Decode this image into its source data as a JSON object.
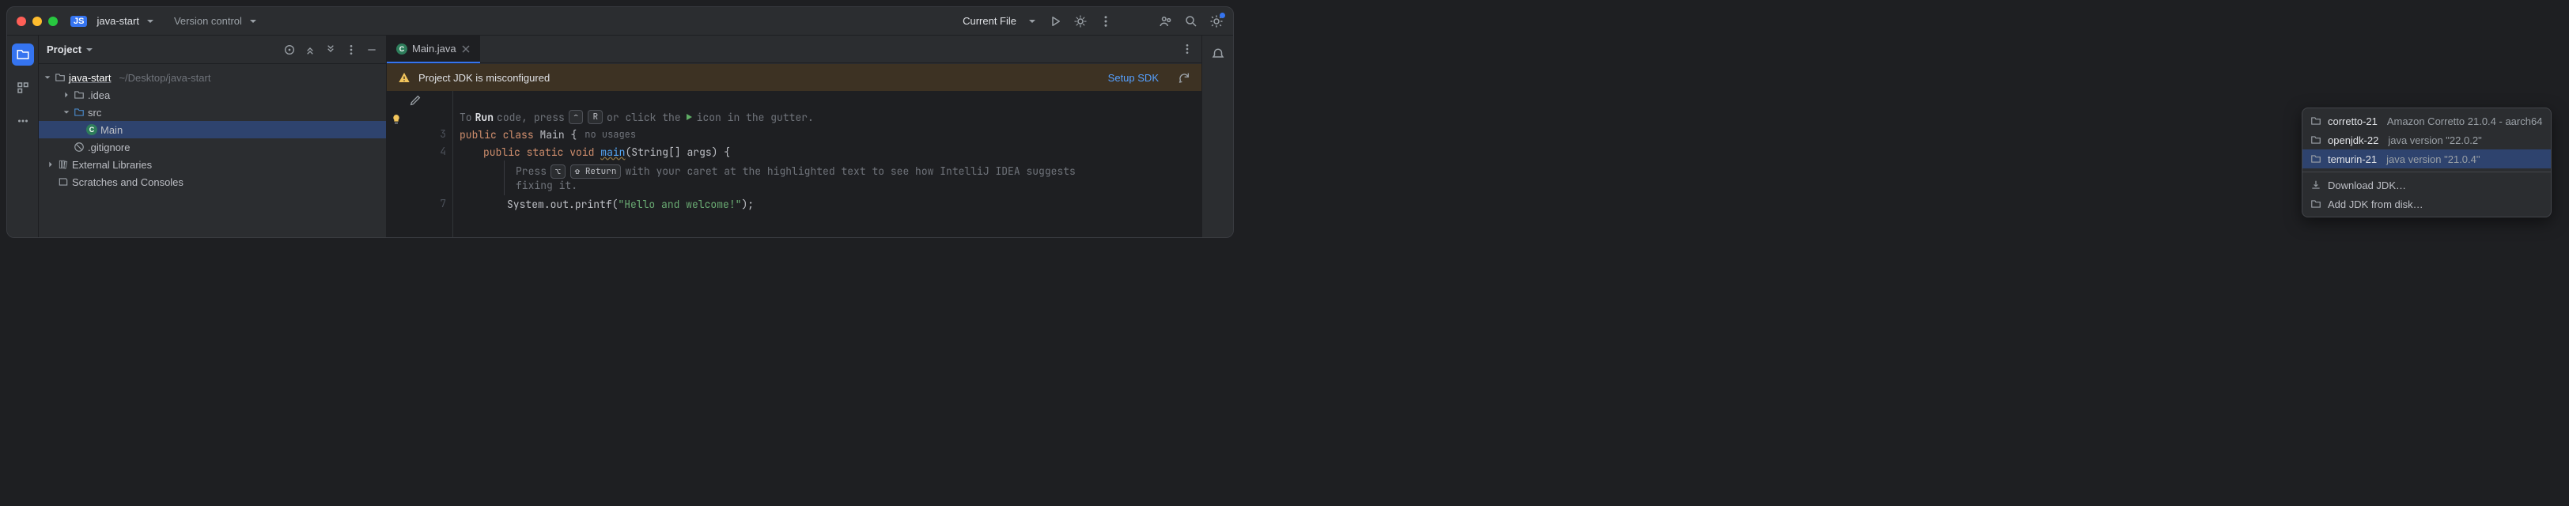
{
  "titlebar": {
    "badge": "JS",
    "project_name": "java-start",
    "version_control": "Version control",
    "current_file": "Current File"
  },
  "sidebar": {
    "title": "Project",
    "tree": {
      "root_name": "java-start",
      "root_path": "~/Desktop/java-start",
      "idea": ".idea",
      "src": "src",
      "main_file": "Main",
      "gitignore": ".gitignore",
      "ext_libs": "External Libraries",
      "scratches": "Scratches and Consoles"
    }
  },
  "tabs": {
    "active": "Main.java"
  },
  "banner": {
    "message": "Project JDK is misconfigured",
    "action": "Setup SDK"
  },
  "editor": {
    "run_prefix": "To ",
    "run_word": "Run",
    "run_suffix": " code, press ",
    "key_ctrl": "⌃",
    "key_r": "R",
    "run_mid": " or click the ",
    "run_end": " icon in the gutter.",
    "line3_kw_public": "public",
    "line3_kw_class": "class",
    "line3_cls": "Main",
    "line3_brace": "{",
    "line3_hint": "no usages",
    "line4_kw_public": "public",
    "line4_kw_static": "static",
    "line4_kw_void": "void",
    "line4_fn": "main",
    "line4_params": "(String[] args) {",
    "doc_press": "Press",
    "doc_key_opt": "⌥",
    "doc_key_return": "⇧ Return",
    "doc_text1": "with your caret at the highlighted text to see how IntelliJ IDEA suggests",
    "doc_text2": "fixing it.",
    "line7_sys": "System",
    "line7_out": ".out.printf(",
    "line7_str": "\"Hello and welcome!\"",
    "line7_end": ");",
    "ln3": "3",
    "ln4": "4",
    "ln7": "7"
  },
  "popup": {
    "items": [
      {
        "name": "corretto-21",
        "desc": "Amazon Corretto 21.0.4 - aarch64"
      },
      {
        "name": "openjdk-22",
        "desc": "java version \"22.0.2\""
      },
      {
        "name": "temurin-21",
        "desc": "java version \"21.0.4\""
      }
    ],
    "download": "Download JDK…",
    "add_disk": "Add JDK from disk…"
  }
}
